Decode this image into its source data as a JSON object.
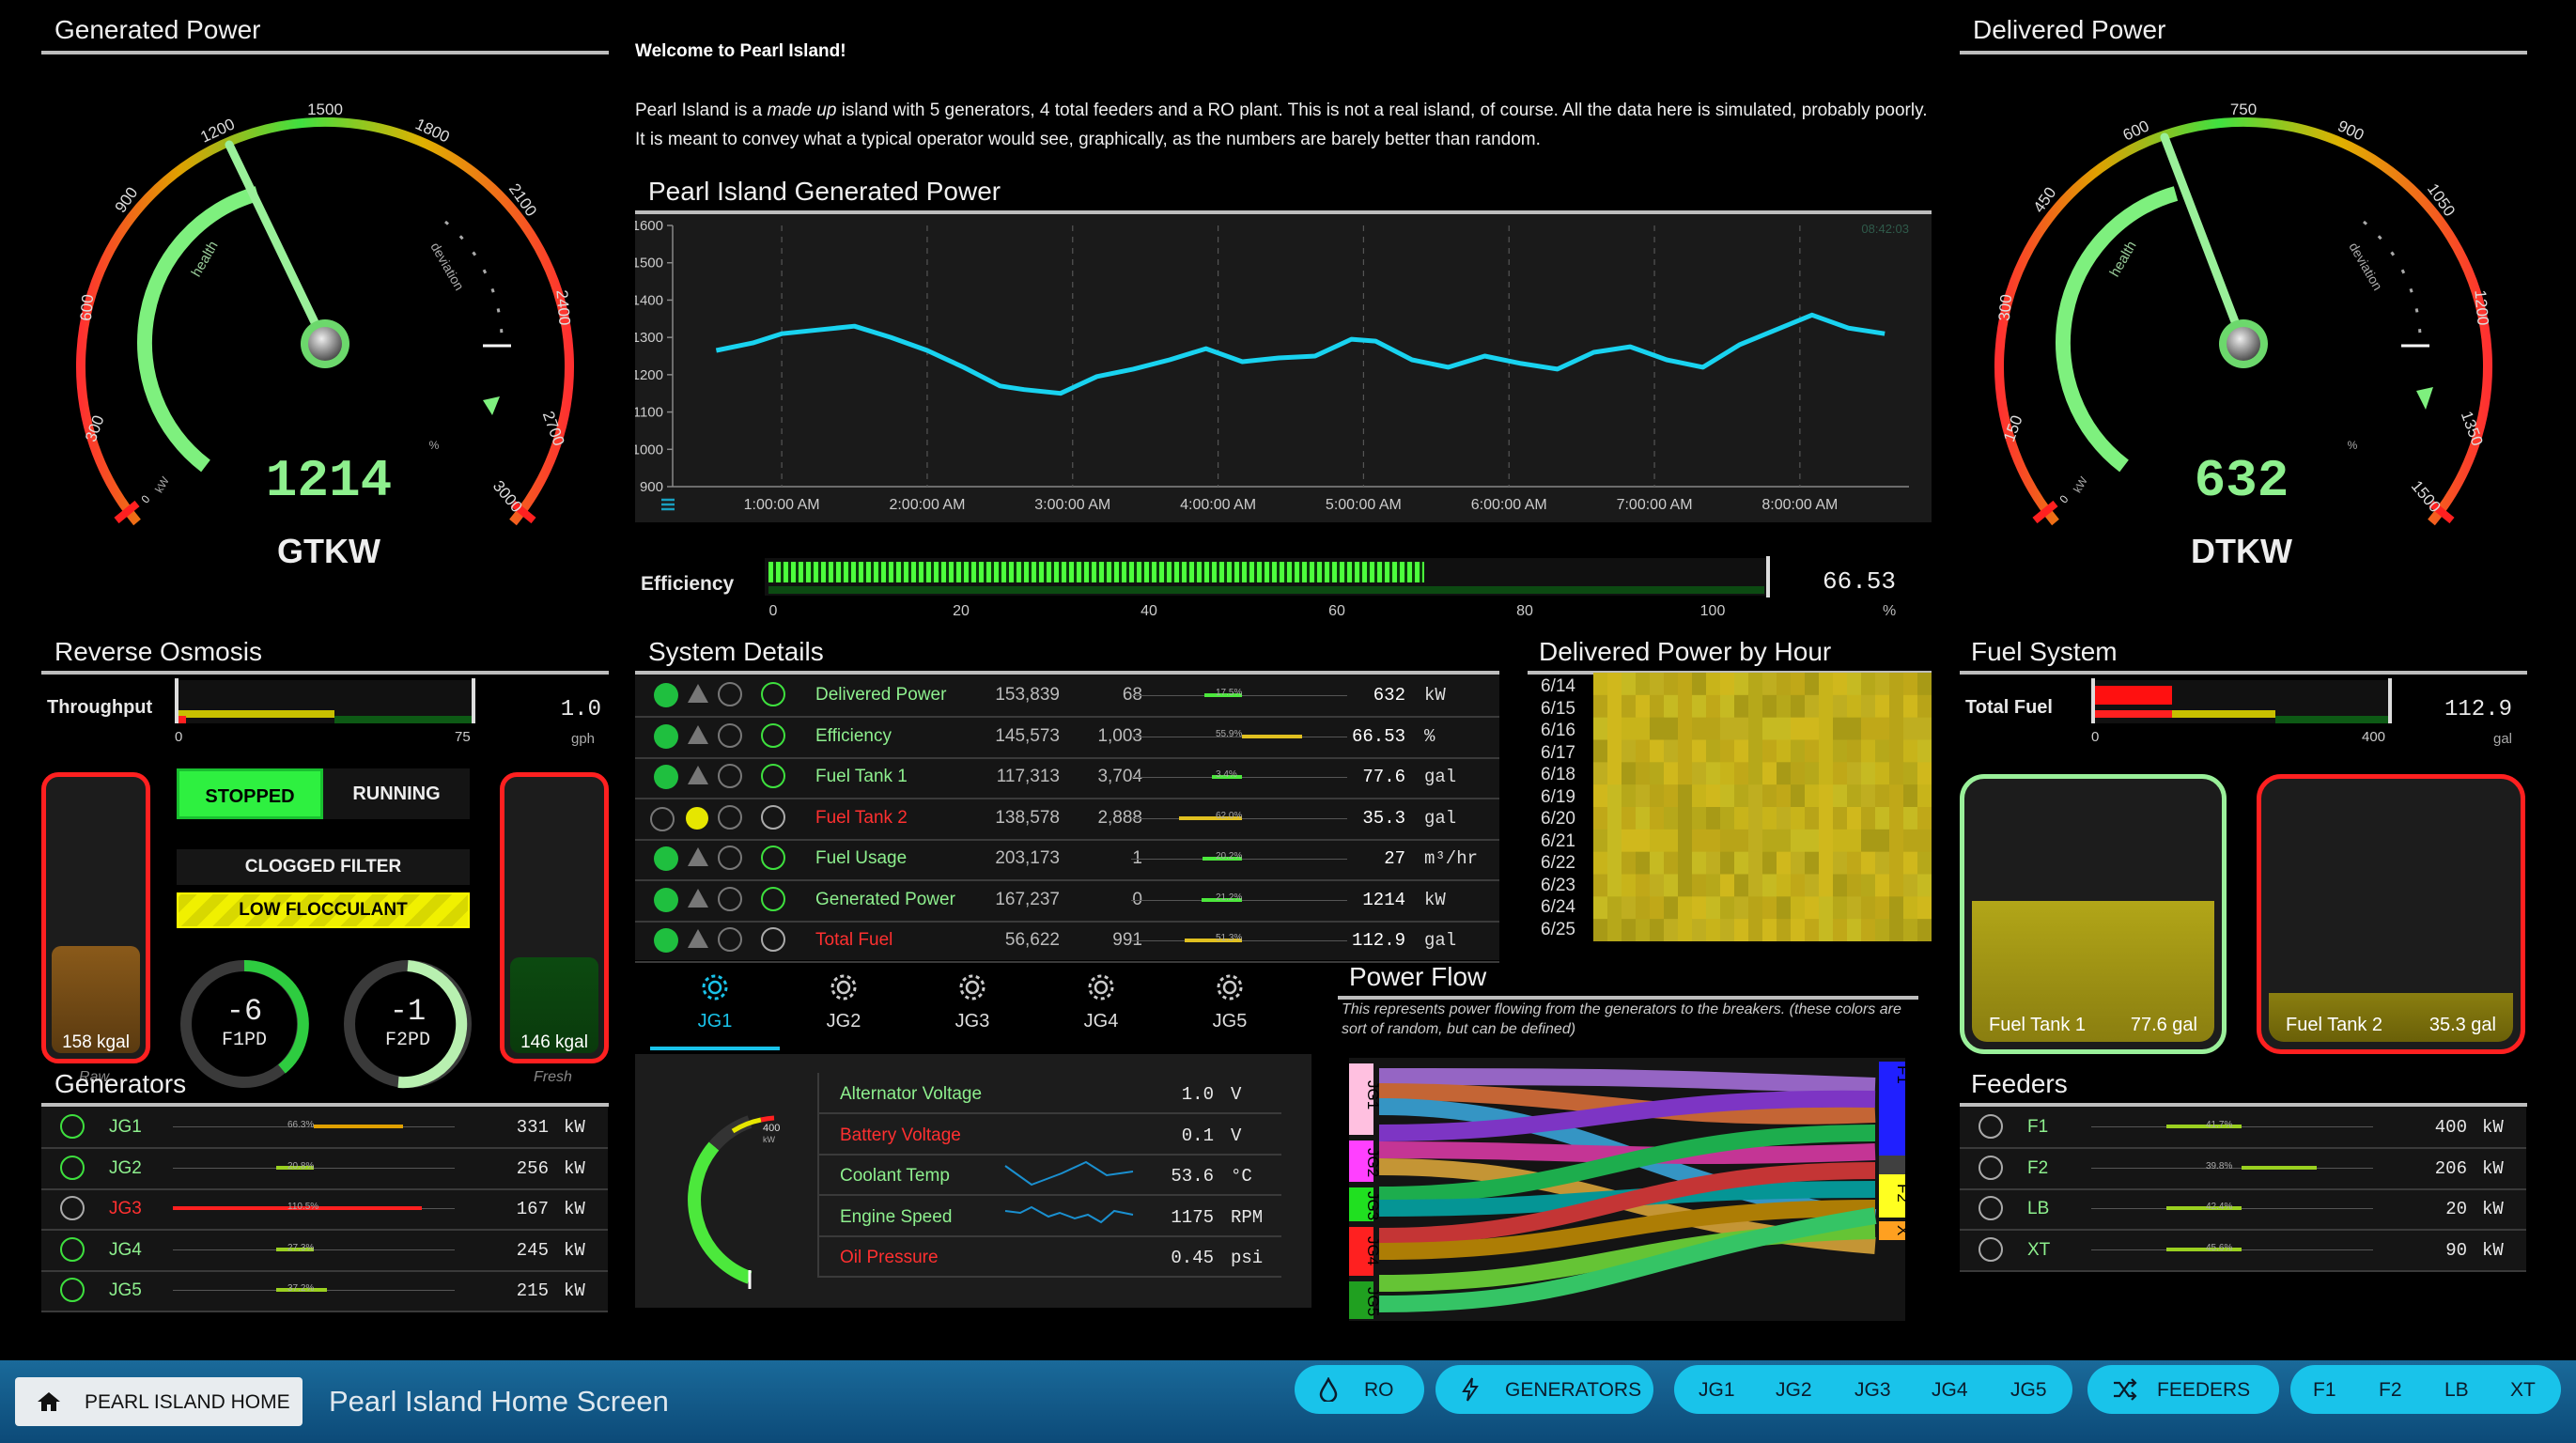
{
  "generated_power": {
    "title": "Generated Power",
    "value": "1214",
    "unit": "GTKW",
    "ticks": [
      "300",
      "600",
      "900",
      "1200",
      "1500",
      "1800",
      "2100",
      "2400",
      "2700",
      "3000"
    ],
    "zero": "0",
    "inner_labels": {
      "health": "health",
      "deviation": "deviation",
      "kw": "kW",
      "pct": "%"
    }
  },
  "delivered_power": {
    "title": "Delivered Power",
    "value": "632",
    "unit": "DTKW",
    "ticks": [
      "150",
      "300",
      "450",
      "600",
      "750",
      "900",
      "1050",
      "1200",
      "1350",
      "1500"
    ],
    "zero": "0",
    "inner_labels": {
      "health": "health",
      "deviation": "deviation",
      "kw": "kW",
      "pct": "%"
    }
  },
  "welcome": {
    "heading": "Welcome to Pearl Island!",
    "p1": "Pearl Island is a ",
    "p1_em": "made up",
    "p2": " island with 5 generators, 4 total feeders and a RO plant.  This is not a real island, of course.  All the data here is simulated, probably poorly.  It is meant to convey what a typical operator would see, graphically, as the numbers are barely better than random."
  },
  "chart_data": {
    "type": "line",
    "title": "Pearl Island Generated Power",
    "ylim": [
      900,
      1600
    ],
    "y_ticks": [
      "1600",
      "1500",
      "1400",
      "1300",
      "1200",
      "1100",
      "1000",
      "900"
    ],
    "x_ticks": [
      "1:00:00 AM",
      "2:00:00 AM",
      "3:00:00 AM",
      "4:00:00 AM",
      "5:00:00 AM",
      "6:00:00 AM",
      "7:00:00 AM",
      "8:00:00 AM"
    ],
    "timestamp": "08:42:03",
    "series": [
      {
        "color": "#19d3f0",
        "x": [
          "0:33",
          "0:48",
          "1:00",
          "1:15",
          "1:30",
          "1:45",
          "2:00",
          "2:15",
          "2:30",
          "2:40",
          "2:55",
          "3:10",
          "3:25",
          "3:40",
          "3:55",
          "4:10",
          "4:25",
          "4:40",
          "4:55",
          "5:05",
          "5:20",
          "5:35",
          "5:50",
          "6:05",
          "6:20",
          "6:35",
          "6:50",
          "7:05",
          "7:20",
          "7:35",
          "7:50",
          "8:05",
          "8:20",
          "8:35"
        ],
        "values": [
          1265,
          1285,
          1310,
          1320,
          1330,
          1300,
          1265,
          1220,
          1170,
          1160,
          1150,
          1195,
          1215,
          1240,
          1270,
          1235,
          1245,
          1250,
          1295,
          1290,
          1240,
          1220,
          1250,
          1230,
          1215,
          1260,
          1275,
          1240,
          1220,
          1280,
          1320,
          1360,
          1325,
          1310
        ]
      }
    ]
  },
  "efficiency": {
    "label": "Efficiency",
    "value": 66.53,
    "value_text": "66.53",
    "unit": "%",
    "ticks": [
      "0",
      "20",
      "40",
      "60",
      "80",
      "100"
    ]
  },
  "ro": {
    "title": "Reverse Osmosis",
    "throughput_label": "Throughput",
    "throughput_value": "1.0",
    "throughput_unit": "gph",
    "scale_min": "0",
    "scale_max": "75",
    "stopped": "STOPPED",
    "running": "RUNNING",
    "alarm1": "CLOGGED FILTER",
    "alarm2": "LOW FLOCCULANT",
    "raw_tank": "158 kgal",
    "raw_label": "Raw",
    "raw_level": 0.38,
    "fresh_tank": "146 kgal",
    "fresh_label": "Fresh",
    "fresh_level": 0.34,
    "f1_value": "-6",
    "f1_label": "F1PD",
    "f2_value": "-1",
    "f2_label": "F2PD"
  },
  "system_details": {
    "title": "System Details",
    "rows": [
      {
        "name": "Delivered Power",
        "a": "153,839",
        "b": "68",
        "pct": "17.5%",
        "value": "632",
        "unit": "kW",
        "alarm": false
      },
      {
        "name": "Efficiency",
        "a": "145,573",
        "b": "1,003",
        "pct": "55.9%",
        "value": "66.53",
        "unit": "%",
        "alarm": false
      },
      {
        "name": "Fuel Tank 1",
        "a": "117,313",
        "b": "3,704",
        "pct": "3.4%",
        "value": "77.6",
        "unit": "gal",
        "alarm": false
      },
      {
        "name": "Fuel Tank 2",
        "a": "138,578",
        "b": "2,888",
        "pct": "62.0%",
        "value": "35.3",
        "unit": "gal",
        "alarm": true
      },
      {
        "name": "Fuel Usage",
        "a": "203,173",
        "b": "1",
        "pct": "20.2%",
        "value": "27",
        "unit": "m³/hr",
        "alarm": false
      },
      {
        "name": "Generated Power",
        "a": "167,237",
        "b": "0",
        "pct": "21.2%",
        "value": "1214",
        "unit": "kW",
        "alarm": false
      },
      {
        "name": "Total Fuel",
        "a": "56,622",
        "b": "991",
        "pct": "51.3%",
        "value": "112.9",
        "unit": "gal",
        "alarm": true
      }
    ]
  },
  "heatmap": {
    "title": "Delivered Power by Hour",
    "rows": [
      "6/14",
      "6/15",
      "6/16",
      "6/17",
      "6/18",
      "6/19",
      "6/20",
      "6/21",
      "6/22",
      "6/23",
      "6/24",
      "6/25"
    ]
  },
  "fuel": {
    "title": "Fuel System",
    "total_label": "Total Fuel",
    "total_value": "112.9",
    "total_unit": "gal",
    "scale_min": "0",
    "scale_max": "400",
    "tank1_label": "Fuel Tank 1",
    "tank1_value": "77.6 gal",
    "tank1_level": 0.52,
    "tank2_label": "Fuel Tank 2",
    "tank2_value": "35.3 gal",
    "tank2_level": 0.18
  },
  "generators": {
    "title": "Generators",
    "rows": [
      {
        "name": "JG1",
        "pct": "66.3%",
        "value": "331",
        "unit": "kW",
        "alarm": false
      },
      {
        "name": "JG2",
        "pct": "20.8%",
        "value": "256",
        "unit": "kW",
        "alarm": false
      },
      {
        "name": "JG3",
        "pct": "110.5%",
        "value": "167",
        "unit": "kW",
        "alarm": true
      },
      {
        "name": "JG4",
        "pct": "27.3%",
        "value": "245",
        "unit": "kW",
        "alarm": false
      },
      {
        "name": "JG5",
        "pct": "37.2%",
        "value": "215",
        "unit": "kW",
        "alarm": false
      }
    ]
  },
  "tabs": [
    "JG1",
    "JG2",
    "JG3",
    "JG4",
    "JG5"
  ],
  "gen_detail": {
    "gauge_value_label": "400",
    "gauge_unit": "kW",
    "rows": [
      {
        "name": "Alternator Voltage",
        "value": "1.0",
        "unit": "V",
        "alarm": false
      },
      {
        "name": "Battery Voltage",
        "value": "0.1",
        "unit": "V",
        "alarm": true
      },
      {
        "name": "Coolant Temp",
        "value": "53.6",
        "unit": "°C",
        "alarm": false
      },
      {
        "name": "Engine Speed",
        "value": "1175",
        "unit": "RPM",
        "alarm": false
      },
      {
        "name": "Oil Pressure",
        "value": "0.45",
        "unit": "psi",
        "alarm": true
      }
    ]
  },
  "power_flow": {
    "title": "Power Flow",
    "desc": "This represents power flowing from the generators to the breakers. (these colors are sort of random, but can be defined)",
    "sources": [
      "JG1",
      "JG2",
      "JG3",
      "JG4",
      "JG5"
    ],
    "targets": [
      "F1",
      "F2",
      "X"
    ]
  },
  "feeders": {
    "title": "Feeders",
    "rows": [
      {
        "name": "F1",
        "pct": "41.7%",
        "value": "400",
        "unit": "kW"
      },
      {
        "name": "F2",
        "pct": "39.8%",
        "value": "206",
        "unit": "kW"
      },
      {
        "name": "LB",
        "pct": "42.4%",
        "value": "20",
        "unit": "kW"
      },
      {
        "name": "XT",
        "pct": "45.6%",
        "value": "90",
        "unit": "kW"
      }
    ]
  },
  "nav": {
    "home": "PEARL ISLAND HOME",
    "screen_title": "Pearl Island Home Screen",
    "ro": "RO",
    "generators": "GENERATORS",
    "gens": [
      "JG1",
      "JG2",
      "JG3",
      "JG4",
      "JG5"
    ],
    "feeders": "FEEDERS",
    "feeder_btns": [
      "F1",
      "F2",
      "LB",
      "XT"
    ]
  },
  "colors": {
    "accent": "#19c3ea",
    "ok": "#1fbf3f",
    "alarm": "#ff2020",
    "warn": "#e6e600"
  }
}
